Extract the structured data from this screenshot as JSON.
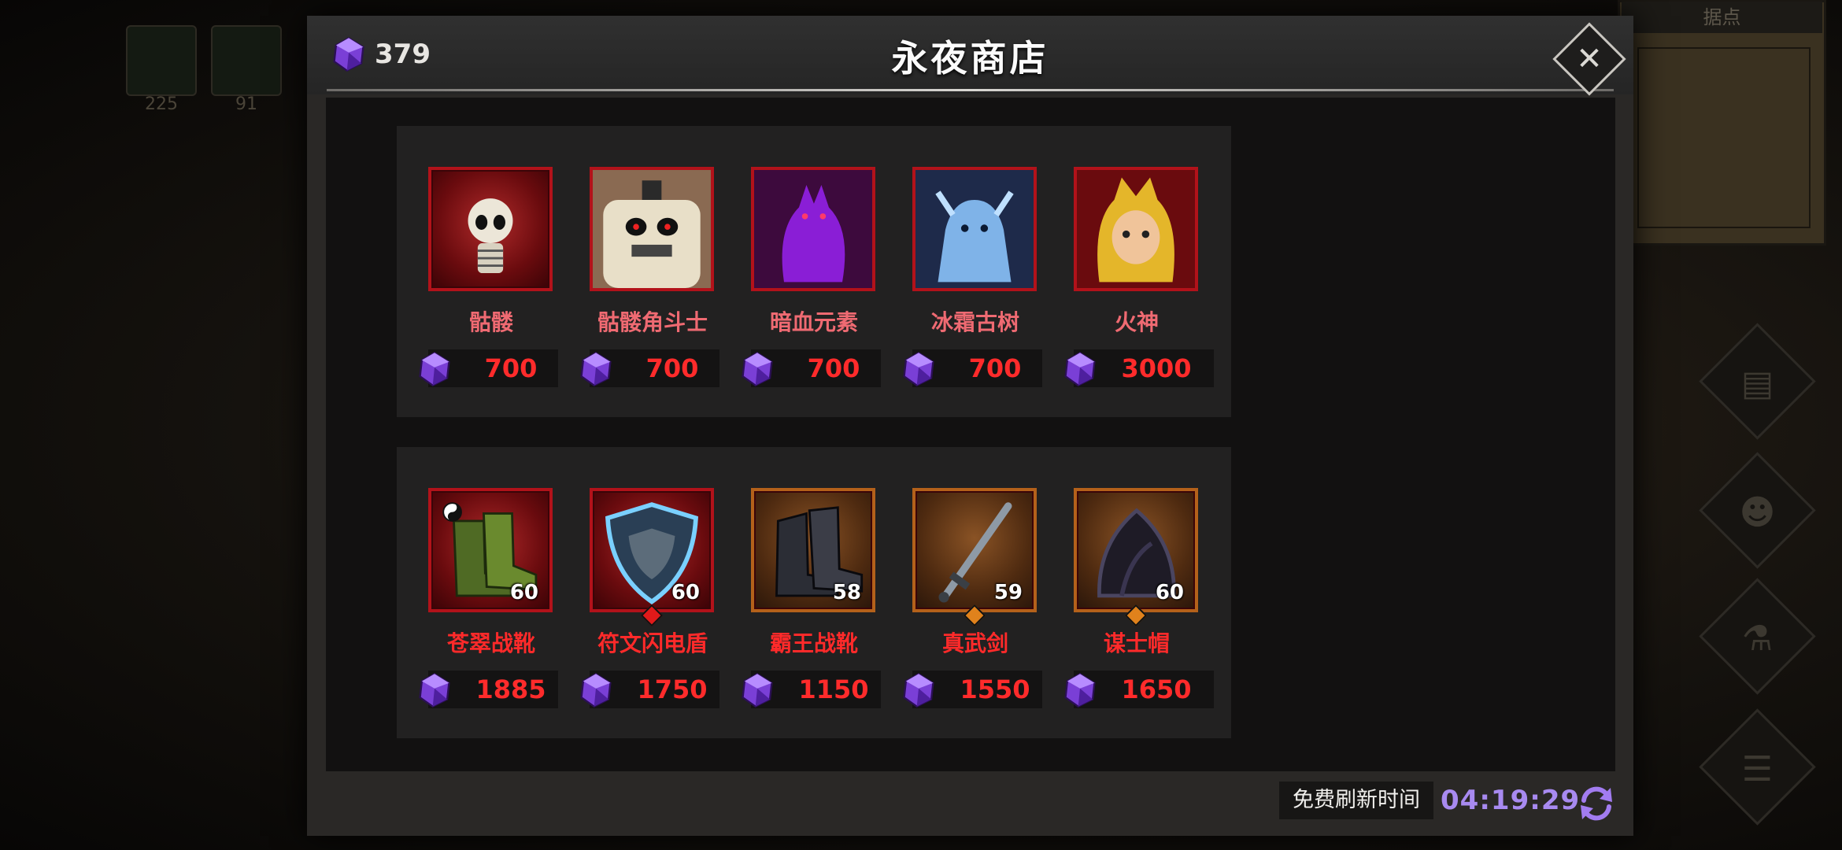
{
  "background": {
    "slots": [
      {
        "count": "225"
      },
      {
        "count": "91"
      }
    ],
    "minimap_title": "据点"
  },
  "shop": {
    "currency_amount": "379",
    "title": "永夜商店",
    "close_icon": "close-icon",
    "cards": [
      {
        "name": "骷髅",
        "price": "700",
        "kind": "hero",
        "frame": "red",
        "art": "skeleton"
      },
      {
        "name": "骷髅角斗士",
        "price": "700",
        "kind": "hero",
        "frame": "red",
        "art": "skeleton-gladiator"
      },
      {
        "name": "暗血元素",
        "price": "700",
        "kind": "hero",
        "frame": "red",
        "art": "dark-blood-elemental"
      },
      {
        "name": "冰霜古树",
        "price": "700",
        "kind": "hero",
        "frame": "red",
        "art": "frost-treant"
      },
      {
        "name": "火神",
        "price": "3000",
        "kind": "hero",
        "frame": "red",
        "art": "fire-god"
      },
      {
        "name": "苍翠战靴",
        "price": "1885",
        "kind": "item",
        "frame": "red",
        "level": "60",
        "art": "green-boots"
      },
      {
        "name": "符文闪电盾",
        "price": "1750",
        "kind": "item",
        "frame": "red",
        "level": "60",
        "art": "rune-shield"
      },
      {
        "name": "霸王战靴",
        "price": "1150",
        "kind": "item",
        "frame": "orange",
        "level": "58",
        "art": "overlord-boots"
      },
      {
        "name": "真武剑",
        "price": "1550",
        "kind": "item",
        "frame": "orange",
        "level": "59",
        "art": "sword"
      },
      {
        "name": "谋士帽",
        "price": "1650",
        "kind": "item",
        "frame": "orange",
        "level": "60",
        "art": "hood"
      }
    ],
    "refresh_label": "免费刷新时间",
    "refresh_timer": "04:19:29",
    "colors": {
      "price_red": "#ff2b2b",
      "timer_purple": "#a88af0",
      "gem_purple": "#8b4fe6"
    }
  }
}
